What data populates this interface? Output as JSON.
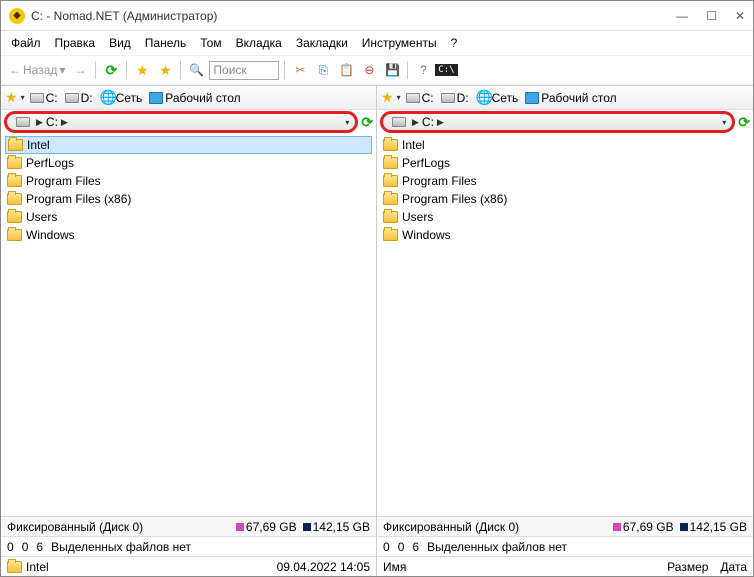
{
  "title": "C: - Nomad.NET (Администратор)",
  "menu": [
    "Файл",
    "Правка",
    "Вид",
    "Панель",
    "Том",
    "Вкладка",
    "Закладки",
    "Инструменты",
    "?"
  ],
  "toolbar": {
    "back": "Назад",
    "search": "Поиск"
  },
  "drives": {
    "c": "C:",
    "d": "D:",
    "net": "Сеть",
    "desktop": "Рабочий стол"
  },
  "addr": {
    "c": "C:"
  },
  "folders": [
    "Intel",
    "PerfLogs",
    "Program Files",
    "Program Files (x86)",
    "Users",
    "Windows"
  ],
  "status": {
    "type": "Фиксированный (Диск 0)",
    "free": "67,69 GB",
    "total": "142,15 GB"
  },
  "sel": {
    "n0": "0",
    "n1": "0",
    "n2": "6",
    "text": "Выделенных файлов нет"
  },
  "leftInfo": {
    "name": "Intel",
    "date": "09.04.2022 14:05"
  },
  "rightInfo": {
    "name": "Имя",
    "size": "Размер",
    "date": "Дата"
  }
}
